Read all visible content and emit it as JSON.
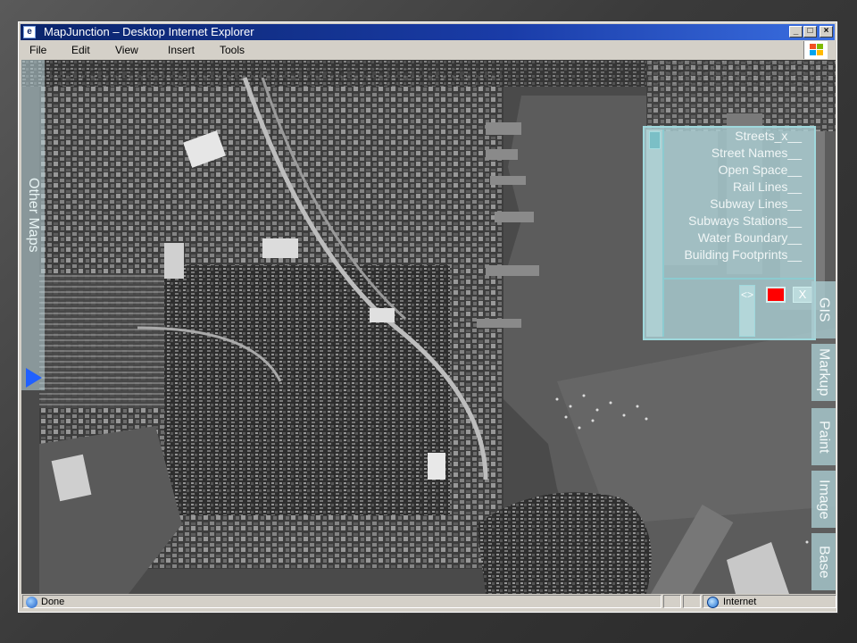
{
  "window": {
    "title": "MapJunction – Desktop  Internet Explorer",
    "buttons": {
      "minimize": "_",
      "maximize": "□",
      "close": "×"
    }
  },
  "menu": [
    "File",
    "Edit",
    "View",
    "Insert",
    "Tools"
  ],
  "left_tab": {
    "label": "Other Maps",
    "expand_icon": "triangle-right-icon"
  },
  "gis_panel": {
    "layers": [
      "Streets_x__",
      "Street Names__",
      "Open Space__",
      "Rail Lines__",
      "Subway Lines__",
      "Subways Stations__",
      "Water Boundary__",
      "Building Footprints__"
    ],
    "resize_label": "<>",
    "close_label": "X",
    "color_swatch": "#ff0000"
  },
  "right_tabs": [
    "GIS",
    "Markup",
    "Paint",
    "Image",
    "Base"
  ],
  "status": {
    "text": "Done",
    "zone": "Internet"
  },
  "colors": {
    "titlebar": "#0a246a",
    "panel": "#aacdd2",
    "arrow": "#2060ff"
  }
}
